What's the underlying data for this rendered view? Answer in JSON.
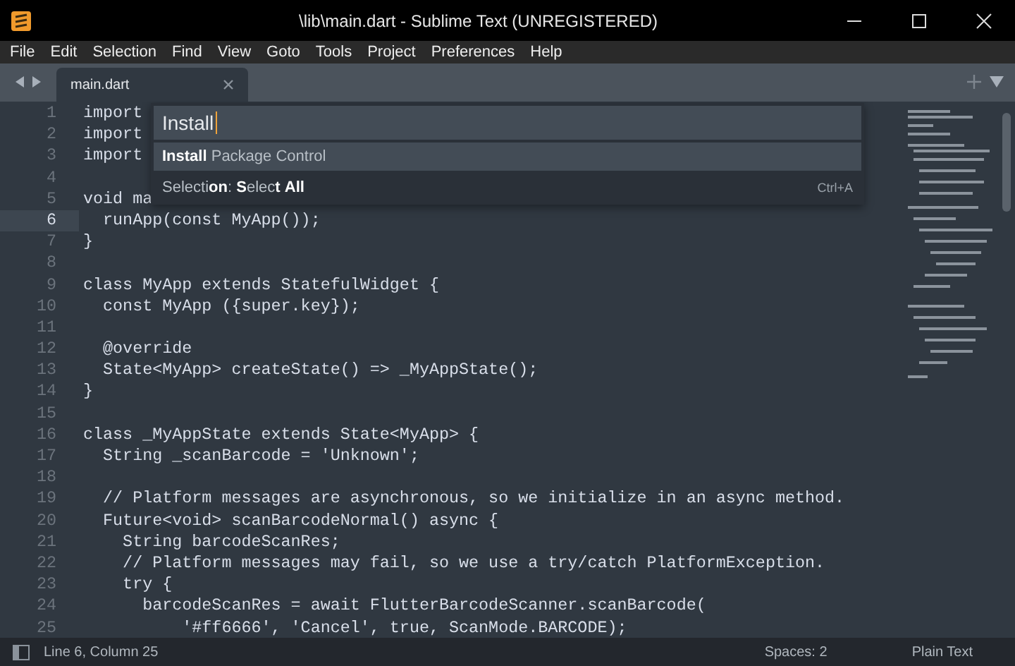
{
  "window": {
    "title": "\\lib\\main.dart - Sublime Text (UNREGISTERED)"
  },
  "menu": [
    "File",
    "Edit",
    "Selection",
    "Find",
    "View",
    "Goto",
    "Tools",
    "Project",
    "Preferences",
    "Help"
  ],
  "tabs": [
    {
      "label": "main.dart",
      "selected": true
    }
  ],
  "code_lines": [
    {
      "number": "1",
      "text": "import",
      "current": false
    },
    {
      "number": "2",
      "text": "import",
      "current": false
    },
    {
      "number": "3",
      "text": "import",
      "current": false
    },
    {
      "number": "4",
      "current": false
    },
    {
      "number": "5",
      "text": "void ma",
      "current": false
    },
    {
      "number": "6",
      "text": "  runApp(const MyApp());",
      "current": true
    },
    {
      "number": "7",
      "text": "}",
      "current": false
    },
    {
      "number": "8",
      "current": false
    },
    {
      "number": "9",
      "text": "class MyApp extends StatefulWidget {",
      "current": false
    },
    {
      "number": "10",
      "text": "  const MyApp ({super.key});",
      "current": false
    },
    {
      "number": "11",
      "current": false
    },
    {
      "number": "12",
      "text": "  @override",
      "current": false
    },
    {
      "number": "13",
      "text": "  State<MyApp> createState() => _MyAppState();",
      "current": false
    },
    {
      "number": "14",
      "text": "}",
      "current": false
    },
    {
      "number": "15",
      "current": false
    },
    {
      "number": "16",
      "text": "class _MyAppState extends State<MyApp> {",
      "current": false
    },
    {
      "number": "17",
      "text": "  String _scanBarcode = 'Unknown';",
      "current": false
    },
    {
      "number": "18",
      "current": false
    },
    {
      "number": "19",
      "text": "  // Platform messages are asynchronous, so we initialize in an async method.",
      "current": false
    },
    {
      "number": "20",
      "text": "  Future<void> scanBarcodeNormal() async {",
      "current": false
    },
    {
      "number": "21",
      "text": "    String barcodeScanRes;",
      "current": false
    },
    {
      "number": "22",
      "text": "    // Platform messages may fail, so we use a try/catch PlatformException.",
      "current": false
    },
    {
      "number": "23",
      "text": "    try {",
      "current": false
    },
    {
      "number": "24",
      "text": "      barcodeScanRes = await FlutterBarcodeScanner.scanBarcode(",
      "current": false
    },
    {
      "number": "25",
      "text": "          '#ff6666', 'Cancel', true, ScanMode.BARCODE);",
      "current": false
    }
  ],
  "command_palette": {
    "query": "Install",
    "items": [
      {
        "label": "**Install** Package Control",
        "selected": true
      },
      {
        "label": "Selecti**on**: **S**elec**t** **All**",
        "shortcut": "Ctrl+A",
        "selected": false
      }
    ]
  },
  "status_bar": {
    "position": "Line 6, Column 25",
    "indentation": "Spaces: 2",
    "syntax": "Plain Text"
  }
}
